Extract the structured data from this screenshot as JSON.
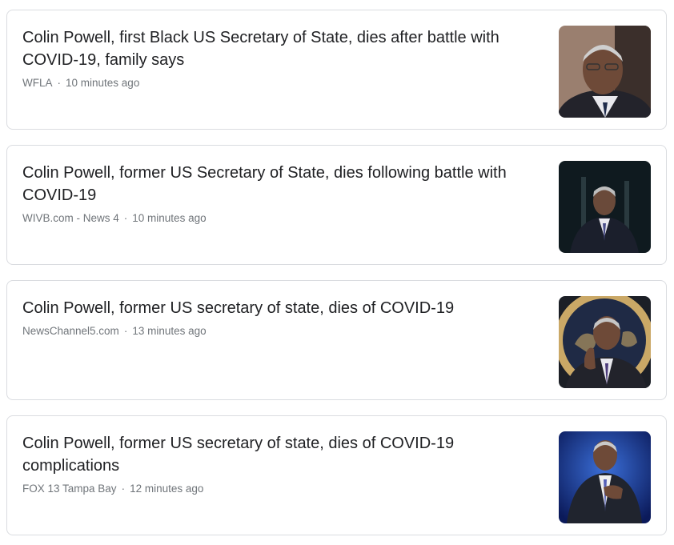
{
  "articles": [
    {
      "headline": "Colin Powell, first Black US Secretary of State, dies after battle with COVID-19, family says",
      "source": "WFLA",
      "time": "10 minutes ago",
      "thumbnail_icon": "news-photo-icon"
    },
    {
      "headline": "Colin Powell, former US Secretary of State, dies following battle with COVID-19",
      "source": "WIVB.com - News 4",
      "time": "10 minutes ago",
      "thumbnail_icon": "news-photo-icon"
    },
    {
      "headline": "Colin Powell, former US secretary of state, dies of COVID-19",
      "source": "NewsChannel5.com",
      "time": "13 minutes ago",
      "thumbnail_icon": "news-photo-icon"
    },
    {
      "headline": "Colin Powell, former US secretary of state, dies of COVID-19 complications",
      "source": "FOX 13 Tampa Bay",
      "time": "12 minutes ago",
      "thumbnail_icon": "news-photo-icon"
    }
  ],
  "separator": "·",
  "colors": {
    "headline": "#202124",
    "meta": "#70757a",
    "border": "#dadce0"
  }
}
